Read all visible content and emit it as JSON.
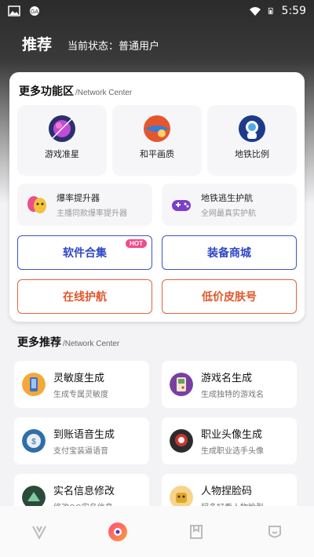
{
  "status_bar": {
    "time": "5:59"
  },
  "header": {
    "title": "推荐",
    "status": "当前状态：普通用户"
  },
  "more_features": {
    "title": "更多功能区",
    "subtitle": "/Network Center",
    "tiles": [
      {
        "label": "游戏准星",
        "icon": "planet-purple-icon"
      },
      {
        "label": "和平画质",
        "icon": "planet-orange-icon"
      },
      {
        "label": "地铁比例",
        "icon": "planet-astronaut-icon"
      }
    ],
    "wide_tiles": [
      {
        "title": "爆率提升器",
        "desc": "主播同款爆率提升器",
        "icon": "masks-icon"
      },
      {
        "title": "地铁逃生护航",
        "desc": "全网最真实护航",
        "icon": "gamepad-icon"
      }
    ],
    "buttons": {
      "software": "软件合集",
      "hot": "HOT",
      "equipment": "装备商城",
      "escort": "在线护航",
      "skins": "低价皮肤号"
    }
  },
  "more_recommend": {
    "title": "更多推荐",
    "subtitle": "/Network Center",
    "items": [
      {
        "title": "灵敏度生成",
        "desc": "生成专属灵敏度",
        "icon": "phone-icon",
        "color": "#3f6fc7"
      },
      {
        "title": "游戏名生成",
        "desc": "生成独特的游戏名",
        "icon": "gameboy-icon",
        "color": "#7a3fa3"
      },
      {
        "title": "到账语音生成",
        "desc": "支付宝装逼语音",
        "icon": "wallet-icon",
        "color": "#2f6ea8"
      },
      {
        "title": "职业头像生成",
        "desc": "生成职业选手头像",
        "icon": "avatar-icon",
        "color": "#c9362e"
      },
      {
        "title": "实名信息修改",
        "desc": "修改QQ实名信息",
        "icon": "id-icon",
        "color": "#2b4a3a"
      },
      {
        "title": "人物捏脸码",
        "desc": "超多好看人物脸型",
        "icon": "face-icon",
        "color": "#e0a62a"
      }
    ]
  },
  "colors": {
    "blue": "#2d47c4",
    "orange": "#e0572a",
    "hot": "#f24a8a"
  }
}
